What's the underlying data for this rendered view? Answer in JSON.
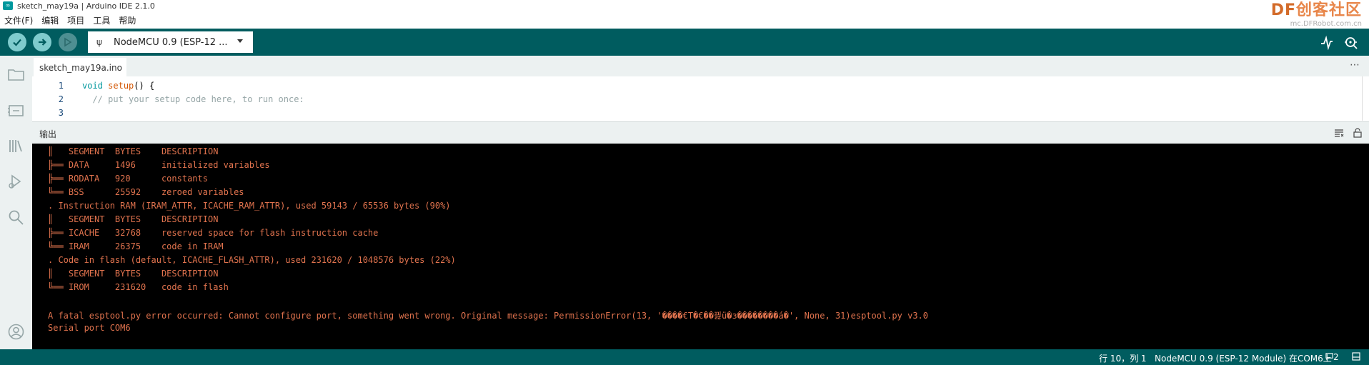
{
  "window": {
    "title": "sketch_may19a | Arduino IDE 2.1.0"
  },
  "watermark": {
    "logo_df": "DF",
    "logo_text": "创客社区",
    "url": "mc.DFRobot.com.cn"
  },
  "menu": {
    "items": [
      "文件(F)",
      "编辑",
      "项目",
      "工具",
      "帮助"
    ]
  },
  "toolbar": {
    "verify": "verify",
    "upload": "upload",
    "debug": "debug",
    "board": "NodeMCU 0.9 (ESP-12 ..."
  },
  "tabs": [
    {
      "label": "sketch_may19a.ino"
    }
  ],
  "editor": {
    "lines": [
      {
        "no": "1",
        "kw": "void",
        "fn": "setup",
        "rest": "() {"
      },
      {
        "no": "2",
        "comment": "  // put your setup code here, to run once:"
      },
      {
        "no": "3"
      }
    ]
  },
  "output": {
    "title": "输出",
    "lines": [
      "║   SEGMENT  BYTES    DESCRIPTION",
      "╠══ DATA     1496     initialized variables",
      "╠══ RODATA   920      constants",
      "╚══ BSS      25592    zeroed variables",
      ". Instruction RAM (IRAM_ATTR, ICACHE_RAM_ATTR), used 59143 / 65536 bytes (90%)",
      "║   SEGMENT  BYTES    DESCRIPTION",
      "╠══ ICACHE   32768    reserved space for flash instruction cache",
      "╚══ IRAM     26375    code in IRAM",
      ". Code in flash (default, ICACHE_FLASH_ATTR), used 231620 / 1048576 bytes (22%)",
      "║   SEGMENT  BYTES    DESCRIPTION",
      "╚══ IROM     231620   code in flash",
      "",
      "A fatal esptool.py error occurred: Cannot configure port, something went wrong. Original message: PermissionError(13, '����€T�€��끯ü�з��������á�', None, 31)esptool.py v3.0",
      "Serial port COM6"
    ]
  },
  "status": {
    "position": "行 10，列 1",
    "board": "NodeMCU 0.9 (ESP-12 Module) 在COM6上",
    "notifications": "2"
  },
  "colors": {
    "teal_dark": "#005c5f",
    "teal_light": "#7fcbcd",
    "console_text": "#e1734e",
    "console_bg": "#000000"
  }
}
